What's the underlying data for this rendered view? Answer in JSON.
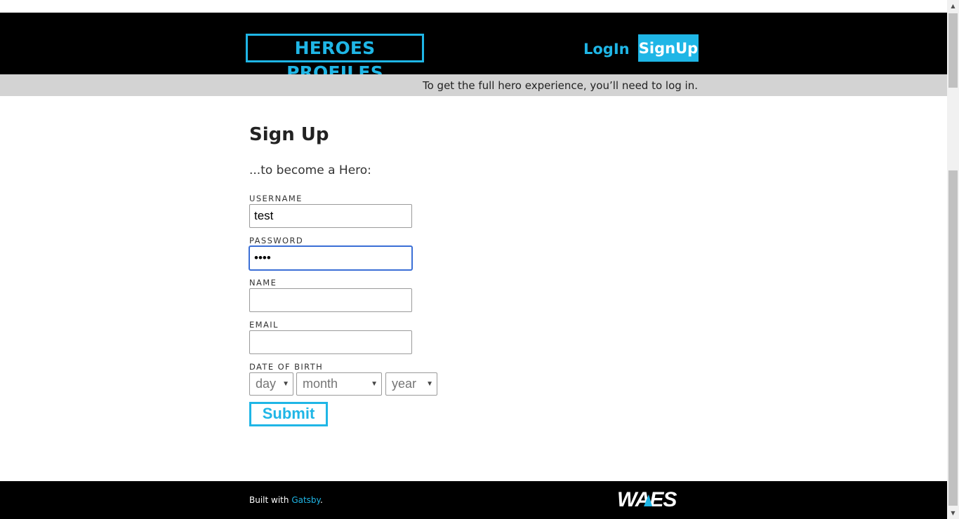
{
  "header": {
    "logo": "HEROES PROFILES",
    "login_label": "LogIn",
    "signup_label": "SignUp"
  },
  "notice": "To get the full hero experience, you’ll need to log in.",
  "form": {
    "title": "Sign Up",
    "subtitle": "...to become a Hero:",
    "username_label": "USERNAME",
    "username_value": "test",
    "password_label": "PASSWORD",
    "password_value": "test",
    "name_label": "NAME",
    "name_value": "",
    "email_label": "EMAIL",
    "email_value": "",
    "dob_label": "DATE OF BIRTH",
    "day_placeholder": "day",
    "month_placeholder": "month",
    "year_placeholder": "year",
    "submit_label": "Submit"
  },
  "footer": {
    "built_with": "Built with ",
    "gatsby_link": "Gatsby",
    "period": ".",
    "logo": "WAES"
  },
  "colors": {
    "accent": "#1fb6e6",
    "header_bg": "#000000",
    "notice_bg": "#d3d3d3"
  }
}
